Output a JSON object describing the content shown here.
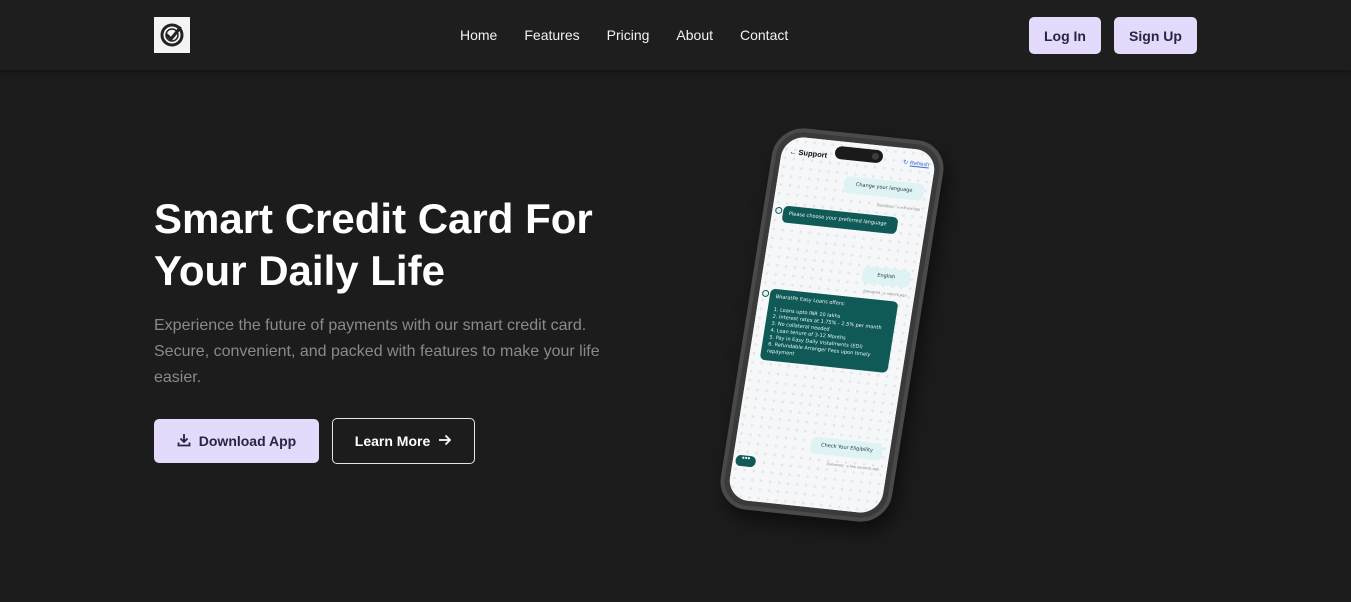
{
  "nav": {
    "links": [
      "Home",
      "Features",
      "Pricing",
      "About",
      "Contact"
    ],
    "login": "Log In",
    "signup": "Sign Up"
  },
  "hero": {
    "title_line1": "Smart Credit Card For",
    "title_line2": "Your Daily Life",
    "subtitle": "Experience the future of payments with our smart credit card. Secure, convenient, and packed with features to make your life easier.",
    "download_label": "Download App",
    "learn_label": "Learn More"
  },
  "phone": {
    "chat_title": "Support",
    "refresh": "Refresh",
    "messages": [
      {
        "text": "Change your language",
        "meta": "Delivered · a minute ago"
      },
      {
        "text": "Please choose your preferred language"
      },
      {
        "text": "English",
        "meta": "Delivered · a minute ago"
      },
      {
        "text": "BharatPe Easy Loans offers:"
      },
      {
        "text": "Check Your Eligibility",
        "meta": "Delivered · a few seconds ago"
      }
    ],
    "offer_items": [
      "1. Loans upto INR 10 lakhs",
      "2. Interest rates at 1.75% - 2.5% per month",
      "3. No collateral needed",
      "4. Loan tenure of 3-12 Months",
      "5. Pay in Easy Daily instalments (EDI)",
      "6. Refundable Arranger Fees upon timely repayment"
    ],
    "typing": "•••"
  },
  "colors": {
    "background": "#1c1c1c",
    "accent": "#e3dafc",
    "chat_bot": "#0f5a57",
    "chat_user": "#dff3f4"
  },
  "icons": [
    "logo-icon",
    "download-icon",
    "arrow-right-icon",
    "back-arrow-icon",
    "refresh-icon"
  ]
}
